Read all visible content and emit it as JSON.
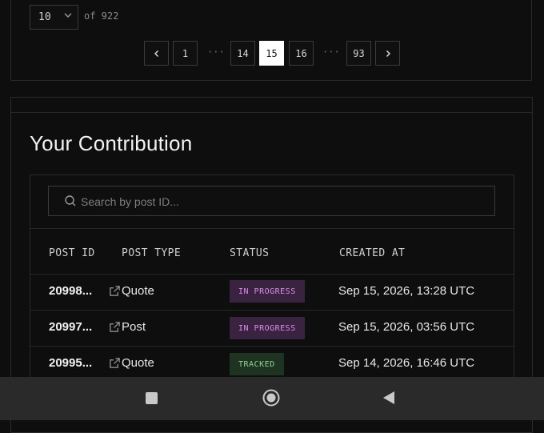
{
  "pagination": {
    "per_page": "10",
    "of_label": "of 922",
    "pages": [
      "1",
      "14",
      "15",
      "16",
      "93"
    ],
    "current_page": "15",
    "ellipsis": "···"
  },
  "contribution": {
    "title": "Your Contribution",
    "search_placeholder": "Search by post ID...",
    "columns": [
      "POST ID",
      "POST TYPE",
      "STATUS",
      "CREATED AT"
    ],
    "rows": [
      {
        "post_id": "20998...",
        "post_type": "Quote",
        "status": "IN PROGRESS",
        "created_at": "Sep 15, 2026, 13:28 UTC"
      },
      {
        "post_id": "20997...",
        "post_type": "Post",
        "status": "IN PROGRESS",
        "created_at": "Sep 15, 2026, 03:56 UTC"
      },
      {
        "post_id": "20995...",
        "post_type": "Quote",
        "status": "TRACKED",
        "created_at": "Sep 14, 2026, 16:46 UTC"
      }
    ]
  },
  "colors": {
    "accent_active_page": "#ffffff",
    "status_in_progress": "#d98fe6",
    "status_tracked": "#8fd38f"
  },
  "icons": [
    "chevron-down-icon",
    "chevron-left-icon",
    "chevron-right-icon",
    "search-icon",
    "external-link-icon",
    "nav-recents-icon",
    "nav-home-icon",
    "nav-back-icon"
  ]
}
